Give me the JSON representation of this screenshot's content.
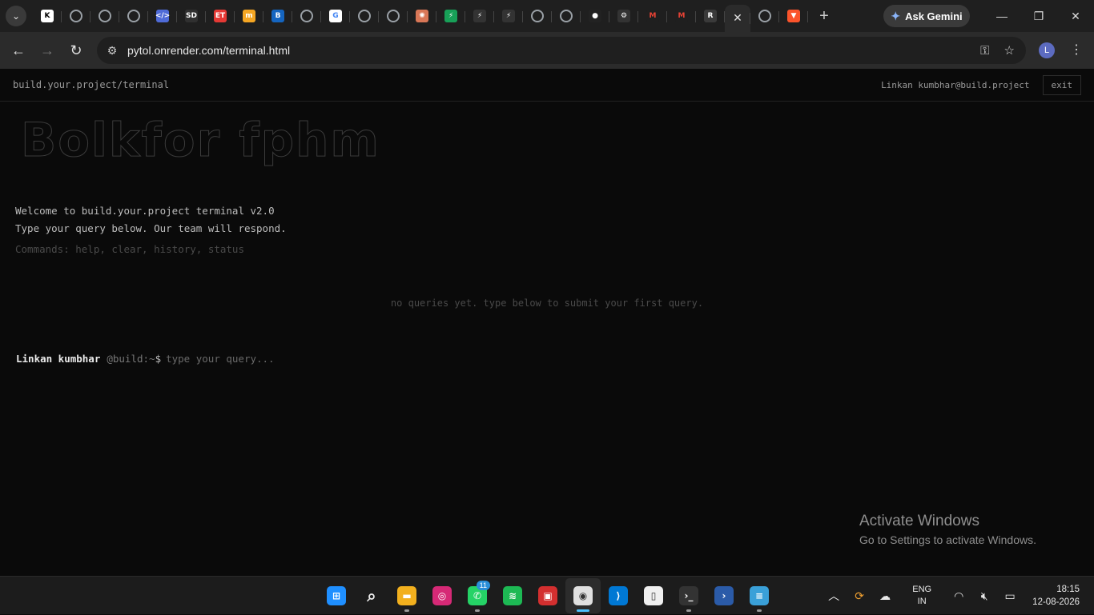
{
  "browser": {
    "tabs": [
      {
        "icon": "k-icon",
        "glyph": "K",
        "color": "#ffffff",
        "fg": "#000000"
      },
      {
        "icon": "globe-icon",
        "glyph": "",
        "color": "globe"
      },
      {
        "icon": "globe-icon",
        "glyph": "",
        "color": "globe"
      },
      {
        "icon": "globe-icon",
        "glyph": "",
        "color": "globe"
      },
      {
        "icon": "code-icon",
        "glyph": "</>",
        "color": "#4f6bd8"
      },
      {
        "icon": "sd-icon",
        "glyph": "SD",
        "color": "#303030"
      },
      {
        "icon": "et-icon",
        "glyph": "ET",
        "color": "#e53935"
      },
      {
        "icon": "coin-icon",
        "glyph": "m",
        "color": "#f5a623"
      },
      {
        "icon": "bc-icon",
        "glyph": "B",
        "color": "#1565c0"
      },
      {
        "icon": "globe-icon",
        "glyph": "",
        "color": "globe"
      },
      {
        "icon": "google-icon",
        "glyph": "G",
        "color": "#ffffff",
        "fg": "#4285f4"
      },
      {
        "icon": "globe-icon",
        "glyph": "",
        "color": "globe"
      },
      {
        "icon": "globe-icon",
        "glyph": "",
        "color": "globe"
      },
      {
        "icon": "claude-icon",
        "glyph": "✺",
        "color": "#d97757"
      },
      {
        "icon": "bolt-icon",
        "glyph": "⚡",
        "color": "#18a058"
      },
      {
        "icon": "bolt-icon",
        "glyph": "⚡",
        "color": "#333333"
      },
      {
        "icon": "bolt-icon",
        "glyph": "⚡",
        "color": "#333333"
      },
      {
        "icon": "globe-icon",
        "glyph": "",
        "color": "globe"
      },
      {
        "icon": "globe-icon",
        "glyph": "",
        "color": "globe"
      },
      {
        "icon": "github-icon",
        "glyph": "●",
        "color": "#222222"
      },
      {
        "icon": "bug-icon",
        "glyph": "⚙",
        "color": "#333333"
      },
      {
        "icon": "gmail-icon",
        "glyph": "M",
        "color": "#1f1f1f",
        "fg": "#ea4335"
      },
      {
        "icon": "gmail-icon",
        "glyph": "M",
        "color": "#1f1f1f",
        "fg": "#ea4335"
      },
      {
        "icon": "render-icon",
        "glyph": "R",
        "color": "#3a3a3a"
      }
    ],
    "active_tab_close": "✕",
    "tabs_after": [
      {
        "icon": "globe-icon",
        "glyph": "",
        "color": "globe"
      },
      {
        "icon": "brave-icon",
        "glyph": "▼",
        "color": "#fb542b"
      }
    ],
    "new_tab": "+",
    "gemini_label": "Ask Gemini",
    "url": "pytol.onrender.com/terminal.html",
    "profile_initial": "L"
  },
  "app": {
    "title": "build.your.project/terminal",
    "user": "Linkan kumbhar@build.project",
    "exit_label": "exit",
    "ascii_banner": "Bolkfor fphm",
    "welcome_line1": "Welcome to build.your.project terminal v2.0",
    "welcome_line2": "Type your query below. Our team will respond.",
    "commands_hint": "Commands: help, clear, history, status",
    "empty_message": "no queries yet. type below to submit your first query.",
    "prompt_user": "Linkan kumbhar",
    "prompt_host": "@build:~",
    "prompt_sign": "$",
    "prompt_placeholder": "type your query..."
  },
  "watermark": {
    "title": "Activate Windows",
    "subtitle": "Go to Settings to activate Windows."
  },
  "taskbar": {
    "apps": [
      {
        "name": "start-button",
        "glyph": "⊞",
        "color": "#1f8fff"
      },
      {
        "name": "search-button",
        "glyph": "⌕",
        "color": "transparent"
      },
      {
        "name": "file-explorer",
        "glyph": "▬",
        "color": "#f2b01e"
      },
      {
        "name": "instagram",
        "glyph": "◎",
        "color": "#d62976"
      },
      {
        "name": "whatsapp",
        "glyph": "✆",
        "color": "#25d366",
        "badge": "11"
      },
      {
        "name": "spotify",
        "glyph": "≋",
        "color": "#1db954"
      },
      {
        "name": "app-red",
        "glyph": "▣",
        "color": "#d32f2f"
      },
      {
        "name": "chrome",
        "glyph": "◉",
        "color": "#e0e0e0",
        "active": true
      },
      {
        "name": "vscode",
        "glyph": "⟩",
        "color": "#0078d4"
      },
      {
        "name": "notepad",
        "glyph": "▯",
        "color": "#f0f0f0"
      },
      {
        "name": "terminal",
        "glyph": "›_",
        "color": "#333333"
      },
      {
        "name": "powershell",
        "glyph": "›",
        "color": "#2b5ba8"
      },
      {
        "name": "notes",
        "glyph": "≡",
        "color": "#3aa0d8"
      }
    ],
    "lang_line1": "ENG",
    "lang_line2": "IN",
    "time": "18:15",
    "date": "12-08-2026"
  }
}
